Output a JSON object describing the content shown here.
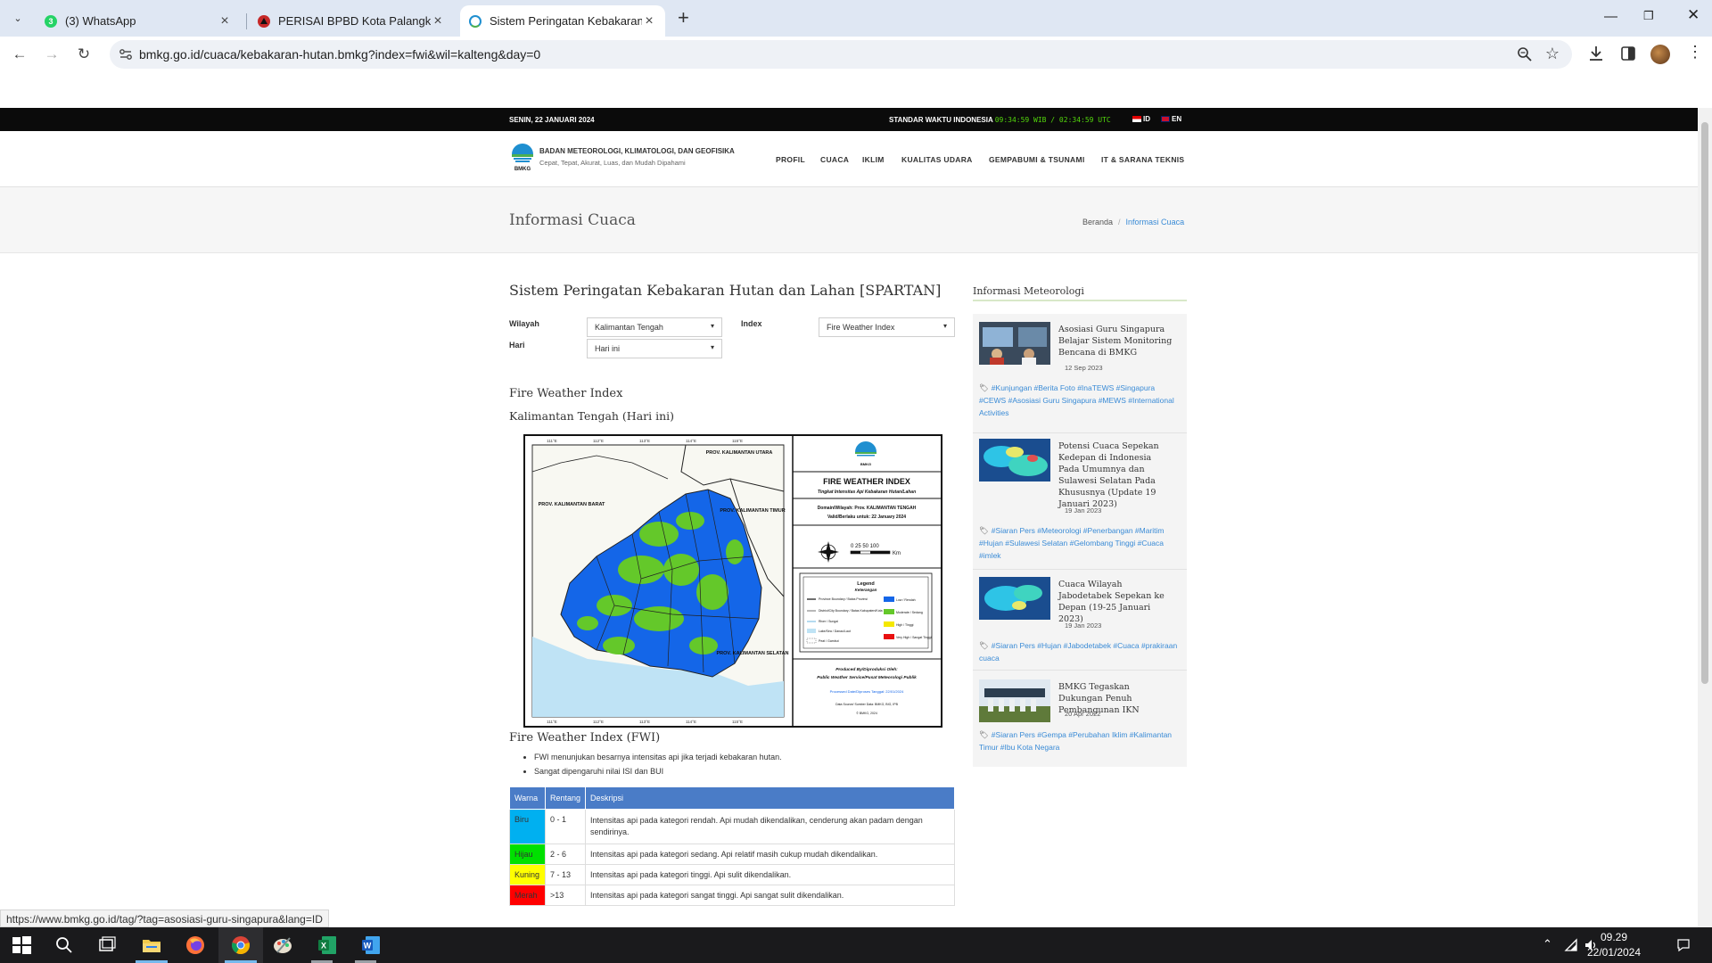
{
  "browser": {
    "tabs": [
      {
        "title": "(3) WhatsApp",
        "badge": "3"
      },
      {
        "title": "PERISAI BPBD Kota Palangka Ra"
      },
      {
        "title": "Sistem Peringatan Kebakaran H"
      }
    ],
    "url": "bmkg.go.id/cuaca/kebakaran-hutan.bmkg?index=fwi&wil=kalteng&day=0",
    "status_url": "https://www.bmkg.go.id/tag/?tag=asosiasi-guru-singapura&lang=ID"
  },
  "topbar": {
    "date": "SENIN, 22 JANUARI 2024",
    "tz_label": "STANDAR WAKTU INDONESIA",
    "clock": "09:34:59 WIB / 02:34:59 UTC",
    "lang_id": "ID",
    "lang_en": "EN"
  },
  "header": {
    "logo_text": "BMKG",
    "brand_name": "BADAN METEOROLOGI, KLIMATOLOGI, DAN GEOFISIKA",
    "tagline": "Cepat, Tepat, Akurat, Luas, dan Mudah Dipahami",
    "nav": [
      "PROFIL",
      "CUACA",
      "IKLIM",
      "KUALITAS UDARA",
      "GEMPABUMI & TSUNAMI",
      "IT & SARANA TEKNIS"
    ]
  },
  "title_band": {
    "title": "Informasi Cuaca",
    "breadcrumb_home": "Beranda",
    "breadcrumb_sep": "/",
    "breadcrumb_current": "Informasi Cuaca"
  },
  "main": {
    "heading": "Sistem Peringatan Kebakaran Hutan dan Lahan [SPARTAN]",
    "form": {
      "wilayah_label": "Wilayah",
      "wilayah_value": "Kalimantan Tengah",
      "hari_label": "Hari",
      "hari_value": "Hari ini",
      "index_label": "Index",
      "index_value": "Fire Weather Index"
    },
    "index_title": "Fire Weather Index",
    "region_title": "Kalimantan Tengah (Hari ini)",
    "map": {
      "title": "FIRE WEATHER INDEX",
      "subtitle": "Tingkat Intensitas Api Kebakaran Hutan/Lahan",
      "domain": "Domain/Wilayah: Prov. KALIMANTAN TENGAH",
      "valid": "Valid/Berlaku untuk: 22 January 2024",
      "scale": "0  25 50     100",
      "scale_unit": "Km",
      "legend_title": "Legend",
      "legend_subtitle": "Keterangan",
      "legend_left": [
        "Province Boundary / Batas Provinsi",
        "District/City Boundary / Batas Kabupaten/Kota",
        "River / Sungai",
        "Lake/Sea / Danau/Laut",
        "Peat / Gambut"
      ],
      "legend_right": [
        "Low / Rendah",
        "Moderate / Sedang",
        "High / Tinggi",
        "Very High / Sangat Tinggi"
      ],
      "produced_by": "Produced By/Diproduksi Oleh:",
      "producer": "Public Weather Service/Pusat Meteorologi Publik",
      "processed": "Processed Date/Diproses Tanggal: 22/01/2024",
      "source": "Data Source/ Sumber Data: BMKG, BIG, IPB",
      "copyright": "© BMKG, 2024",
      "prov_labels": [
        "PROV. KALIMANTAN UTARA",
        "PROV. KALIMANTAN TIMUR",
        "PROV. KALIMANTAN BARAT",
        "PROV. KALIMANTAN SELATAN"
      ],
      "lon_ticks": [
        "111°E",
        "112°E",
        "113°E",
        "114°E",
        "115°E"
      ],
      "colors": {
        "low": "#1466e8",
        "moderate": "#64c82a",
        "high": "#f5e800",
        "very_high": "#e81010",
        "sea": "#bfe3f5"
      }
    },
    "fwi_heading": "Fire Weather Index (FWI)",
    "bullets": [
      "FWI menunjukan besarnya intensitas api jika terjadi kebakaran hutan.",
      "Sangat dipengaruhi nilai ISI dan BUI"
    ],
    "table": {
      "headers": [
        "Warna",
        "Rentang",
        "Deskripsi"
      ],
      "rows": [
        {
          "color": "Biru",
          "bg": "#00b0f0",
          "range": "0 - 1",
          "desc": "Intensitas api pada kategori rendah. Api mudah dikendalikan, cenderung akan padam dengan sendirinya."
        },
        {
          "color": "Hijau",
          "bg": "#00e000",
          "range": "2 - 6",
          "desc": "Intensitas api pada kategori sedang. Api relatif masih cukup mudah dikendalikan."
        },
        {
          "color": "Kuning",
          "bg": "#ffff00",
          "range": "7 - 13",
          "desc": "Intensitas api pada kategori tinggi. Api sulit dikendalikan."
        },
        {
          "color": "Merah",
          "bg": "#ff0000",
          "range": ">13",
          "desc": "Intensitas api pada kategori sangat tinggi. Api sangat sulit dikendalikan."
        }
      ]
    }
  },
  "sidebar": {
    "title": "Informasi Meteorologi",
    "news": [
      {
        "headline": "Asosiasi Guru Singapura Belajar Sistem Monitoring Bencana di BMKG",
        "date": "12 Sep 2023",
        "tags": "#Kunjungan #Berita Foto #InaTEWS #Singapura #CEWS #Asosiasi Guru Singapura #MEWS #International Activities"
      },
      {
        "headline": "Potensi Cuaca Sepekan Kedepan di Indonesia Pada Umumnya dan Sulawesi Selatan Pada Khususnya (Update 19 Januari 2023)",
        "date": "19 Jan 2023",
        "tags": "#Siaran Pers #Meteorologi #Penerbangan #Maritim #Hujan #Sulawesi Selatan #Gelombang Tinggi #Cuaca #imlek"
      },
      {
        "headline": "Cuaca Wilayah Jabodetabek Sepekan ke Depan (19-25 Januari 2023)",
        "date": "19 Jan 2023",
        "tags": "#Siaran Pers #Hujan #Jabodetabek #Cuaca #prakiraan cuaca"
      },
      {
        "headline": "BMKG Tegaskan Dukungan Penuh Pembangunan IKN",
        "date": "20 Apr 2022",
        "tags": "#Siaran Pers #Gempa #Perubahan Iklim #Kalimantan Timur #Ibu Kota Negara"
      }
    ]
  },
  "taskbar": {
    "time": "09.29",
    "date": "22/01/2024"
  }
}
